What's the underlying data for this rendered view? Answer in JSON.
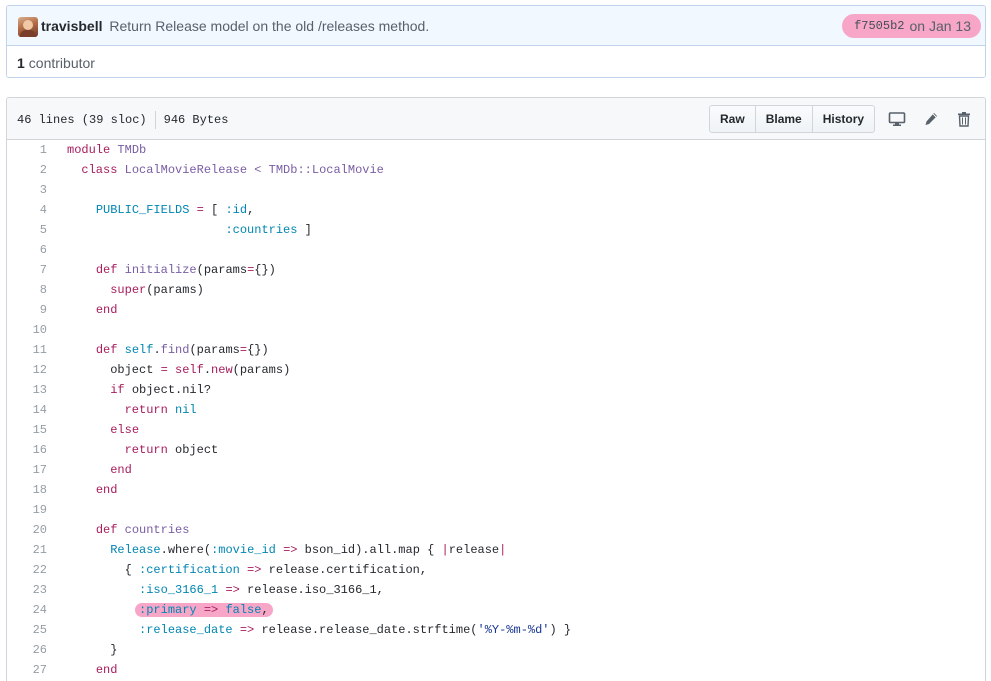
{
  "commit": {
    "author": "travisbell",
    "message": "Return Release model on the old /releases method.",
    "sha": "f7505b2",
    "date": "on Jan 13",
    "contributors_count": "1",
    "contributors_label": "contributor"
  },
  "file": {
    "lines_info": "46 lines (39 sloc)",
    "size": "946 Bytes",
    "buttons": {
      "raw": "Raw",
      "blame": "Blame",
      "history": "History"
    },
    "icons": [
      "desktop-icon",
      "pencil-icon",
      "trash-icon"
    ]
  },
  "colors": {
    "keyword": "#a71d5d",
    "entity": "#795da3",
    "constant": "#0086b3",
    "string": "#183691",
    "highlight": "#f7a6c8"
  },
  "code_lines": [
    {
      "n": "1",
      "t": [
        {
          "c": "k",
          "v": "module"
        },
        {
          "v": " "
        },
        {
          "c": "e",
          "v": "TMDb"
        }
      ]
    },
    {
      "n": "2",
      "t": [
        {
          "v": "  "
        },
        {
          "c": "k",
          "v": "class"
        },
        {
          "v": " "
        },
        {
          "c": "e",
          "v": "LocalMovieRelease"
        },
        {
          "v": " "
        },
        {
          "c": "e",
          "v": "<"
        },
        {
          "v": " "
        },
        {
          "c": "e",
          "v": "TMDb::LocalMovie"
        }
      ]
    },
    {
      "n": "3",
      "t": []
    },
    {
      "n": "4",
      "t": [
        {
          "v": "    "
        },
        {
          "c": "c",
          "v": "PUBLIC_FIELDS"
        },
        {
          "v": " "
        },
        {
          "c": "k",
          "v": "="
        },
        {
          "v": " [ "
        },
        {
          "c": "c",
          "v": ":id"
        },
        {
          "v": ","
        }
      ]
    },
    {
      "n": "5",
      "t": [
        {
          "v": "                      "
        },
        {
          "c": "c",
          "v": ":countries"
        },
        {
          "v": " ]"
        }
      ]
    },
    {
      "n": "6",
      "t": []
    },
    {
      "n": "7",
      "t": [
        {
          "v": "    "
        },
        {
          "c": "k",
          "v": "def"
        },
        {
          "v": " "
        },
        {
          "c": "e",
          "v": "initialize"
        },
        {
          "v": "(params"
        },
        {
          "c": "k",
          "v": "="
        },
        {
          "v": "{})"
        }
      ]
    },
    {
      "n": "8",
      "t": [
        {
          "v": "      "
        },
        {
          "c": "k",
          "v": "super"
        },
        {
          "v": "(params)"
        }
      ]
    },
    {
      "n": "9",
      "t": [
        {
          "v": "    "
        },
        {
          "c": "k",
          "v": "end"
        }
      ]
    },
    {
      "n": "10",
      "t": []
    },
    {
      "n": "11",
      "t": [
        {
          "v": "    "
        },
        {
          "c": "k",
          "v": "def"
        },
        {
          "v": " "
        },
        {
          "c": "c",
          "v": "self"
        },
        {
          "v": "."
        },
        {
          "c": "e",
          "v": "find"
        },
        {
          "v": "(params"
        },
        {
          "c": "k",
          "v": "="
        },
        {
          "v": "{})"
        }
      ]
    },
    {
      "n": "12",
      "t": [
        {
          "v": "      object "
        },
        {
          "c": "k",
          "v": "="
        },
        {
          "v": " "
        },
        {
          "c": "k",
          "v": "self"
        },
        {
          "v": "."
        },
        {
          "c": "k",
          "v": "new"
        },
        {
          "v": "(params)"
        }
      ]
    },
    {
      "n": "13",
      "t": [
        {
          "v": "      "
        },
        {
          "c": "k",
          "v": "if"
        },
        {
          "v": " object.nil?"
        }
      ]
    },
    {
      "n": "14",
      "t": [
        {
          "v": "        "
        },
        {
          "c": "k",
          "v": "return"
        },
        {
          "v": " "
        },
        {
          "c": "c",
          "v": "nil"
        }
      ]
    },
    {
      "n": "15",
      "t": [
        {
          "v": "      "
        },
        {
          "c": "k",
          "v": "else"
        }
      ]
    },
    {
      "n": "16",
      "t": [
        {
          "v": "        "
        },
        {
          "c": "k",
          "v": "return"
        },
        {
          "v": " object"
        }
      ]
    },
    {
      "n": "17",
      "t": [
        {
          "v": "      "
        },
        {
          "c": "k",
          "v": "end"
        }
      ]
    },
    {
      "n": "18",
      "t": [
        {
          "v": "    "
        },
        {
          "c": "k",
          "v": "end"
        }
      ]
    },
    {
      "n": "19",
      "t": []
    },
    {
      "n": "20",
      "t": [
        {
          "v": "    "
        },
        {
          "c": "k",
          "v": "def"
        },
        {
          "v": " "
        },
        {
          "c": "e",
          "v": "countries"
        }
      ]
    },
    {
      "n": "21",
      "t": [
        {
          "v": "      "
        },
        {
          "c": "c",
          "v": "Release"
        },
        {
          "v": ".where("
        },
        {
          "c": "c",
          "v": ":movie_id"
        },
        {
          "v": " "
        },
        {
          "c": "k",
          "v": "=>"
        },
        {
          "v": " bson_id).all.map { "
        },
        {
          "c": "k",
          "v": "|"
        },
        {
          "v": "release"
        },
        {
          "c": "k",
          "v": "|"
        }
      ]
    },
    {
      "n": "22",
      "t": [
        {
          "v": "        { "
        },
        {
          "c": "c",
          "v": ":certification"
        },
        {
          "v": " "
        },
        {
          "c": "k",
          "v": "=>"
        },
        {
          "v": " release.certification,"
        }
      ]
    },
    {
      "n": "23",
      "t": [
        {
          "v": "          "
        },
        {
          "c": "c",
          "v": ":iso_3166_1"
        },
        {
          "v": " "
        },
        {
          "c": "k",
          "v": "=>"
        },
        {
          "v": " release.iso_3166_1,"
        }
      ]
    },
    {
      "n": "24",
      "hl": true,
      "t": [
        {
          "v": "          "
        },
        {
          "c": "c",
          "v": ":primary"
        },
        {
          "v": " "
        },
        {
          "c": "k",
          "v": "=>"
        },
        {
          "v": " "
        },
        {
          "c": "c",
          "v": "false"
        },
        {
          "v": ","
        }
      ]
    },
    {
      "n": "25",
      "t": [
        {
          "v": "          "
        },
        {
          "c": "c",
          "v": ":release_date"
        },
        {
          "v": " "
        },
        {
          "c": "k",
          "v": "=>"
        },
        {
          "v": " release.release_date.strftime("
        },
        {
          "c": "s",
          "v": "'%Y-%m-%d'"
        },
        {
          "v": ") }"
        }
      ]
    },
    {
      "n": "26",
      "t": [
        {
          "v": "      }"
        }
      ]
    },
    {
      "n": "27",
      "t": [
        {
          "v": "    "
        },
        {
          "c": "k",
          "v": "end"
        }
      ]
    }
  ]
}
